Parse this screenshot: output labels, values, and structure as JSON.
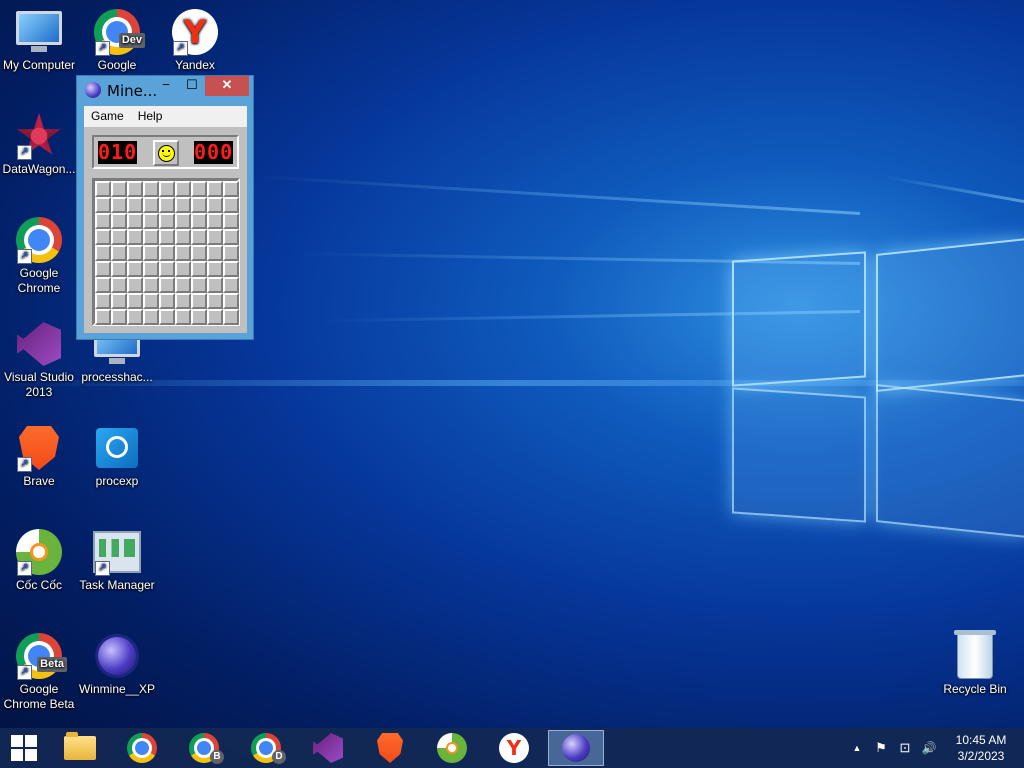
{
  "desktop": {
    "icons": [
      {
        "label": "My Computer"
      },
      {
        "label": "Google",
        "tag": "Dev"
      },
      {
        "label": "Yandex",
        "glyph": "Y"
      },
      {
        "label": "DataWagon..."
      },
      {
        "label": "Google Chrome"
      },
      {
        "label": "Visual Studio 2013"
      },
      {
        "label": "processhac..."
      },
      {
        "label": "Brave"
      },
      {
        "label": "procexp"
      },
      {
        "label": "Cốc Cốc"
      },
      {
        "label": "Task Manager"
      },
      {
        "label": "Google Chrome Beta",
        "tag": "Beta"
      },
      {
        "label": "Winmine__XP"
      },
      {
        "label": "Recycle Bin"
      }
    ]
  },
  "minesweeper": {
    "title": "Mine...",
    "minimize": "−",
    "maximize": "☐",
    "close": "✕",
    "menu": [
      "Game",
      "Help"
    ],
    "mine_counter": "010",
    "timer": "000",
    "rows": 9,
    "cols": 9
  },
  "taskbar": {
    "pinned": [
      {
        "name": "file-explorer"
      },
      {
        "name": "google-chrome"
      },
      {
        "name": "chrome-beta",
        "letter": "B"
      },
      {
        "name": "chrome-dev",
        "letter": "D"
      },
      {
        "name": "visual-studio"
      },
      {
        "name": "brave"
      },
      {
        "name": "coc-coc"
      },
      {
        "name": "yandex",
        "glyph": "Y"
      },
      {
        "name": "minesweeper",
        "active": true
      }
    ],
    "tray": {
      "chevron": "▲",
      "flag": "⚑",
      "network": "⊡",
      "volume": "🔊"
    },
    "clock": {
      "time": "10:45 AM",
      "date": "3/2/2023"
    }
  },
  "colors": {
    "accent": "#5aa3d8",
    "close": "#c75050",
    "lcd": "#ff1b1b"
  }
}
